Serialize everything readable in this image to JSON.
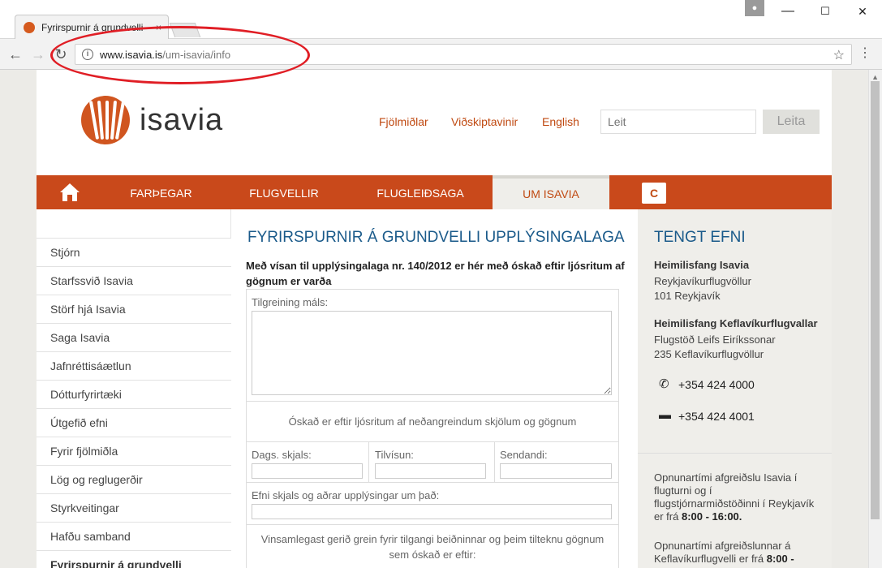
{
  "browser": {
    "tab_title": "Fyrirspurnir á grundvelli",
    "tab_close": "×",
    "back": "←",
    "forward": "→",
    "reload": "↻",
    "url_domain": "www.isavia.is",
    "url_path": "/um-isavia/info",
    "info_glyph": "i",
    "star": "☆",
    "menu": "⋮",
    "win_min": "—",
    "win_max": "☐",
    "win_close": "✕"
  },
  "header": {
    "logo_text": "isavia",
    "links": [
      "Fjölmiðlar",
      "Viðskiptavinir",
      "English"
    ],
    "search_placeholder": "Leit",
    "search_button": "Leita"
  },
  "nav": {
    "items": [
      "FARÞEGAR",
      "FLUGVELLIR",
      "FLUGLEIÐSAGA",
      "UM ISAVIA"
    ],
    "c_label": "C"
  },
  "sidebar": {
    "items": [
      "Stjórn",
      "Starfssvið Isavia",
      "Störf hjá Isavia",
      "Saga Isavia",
      "Jafnréttisáætlun",
      "Dótturfyrirtæki",
      "Útgefið efni",
      "Fyrir fjölmiðla",
      "Lög og reglugerðir",
      "Styrkveitingar",
      "Hafðu samband",
      "Fyrirspurnir á grundvelli"
    ]
  },
  "main": {
    "title": "FYRIRSPURNIR Á GRUNDVELLI UPPLÝSINGALAGA",
    "intro": "Með vísan til upplýsingalaga nr. 140/2012 er hér með óskað eftir ljósritum af gögnum er varða",
    "label_subject": "Tilgreining máls:",
    "label_requested": "Óskað er eftir ljósritum af neðangreindum skjölum og gögnum",
    "label_date": "Dags. skjals:",
    "label_reference": "Tilvísun:",
    "label_sender": "Sendandi:",
    "label_content": "Efni skjals og aðrar upplýsingar um það:",
    "label_purpose": "Vinsamlegast gerið grein fyrir tilgangi beiðninnar og þeim tilteknu gögnum sem óskað er eftir:"
  },
  "related": {
    "title": "TENGT EFNI",
    "addr1_title": "Heimilisfang Isavia",
    "addr1_line1": "Reykjavíkurflugvöllur",
    "addr1_line2": "101 Reykjavík",
    "addr2_title": "Heimilisfang Keflavíkurflugvallar",
    "addr2_line1": "Flugstöð Leifs Eiríkssonar",
    "addr2_line2": "235 Keflavíkurflugvöllur",
    "phone": "+354 424 4000",
    "fax": "+354 424 4001",
    "hours1_text": "Opnunartími afgreiðslu Isavia í flugturni og í flugstjórnarmiðstöðinni í Reykjavík er frá",
    "hours1_time": "8:00 - 16:00.",
    "hours2_text": "Opnunartími afgreiðslunnar á Keflavíkurflugvelli er frá",
    "hours2_time": "8:00 -"
  },
  "colors": {
    "brand_orange": "#c9491b",
    "heading_blue": "#1a5a8a",
    "annotation_red": "#e01e25"
  }
}
